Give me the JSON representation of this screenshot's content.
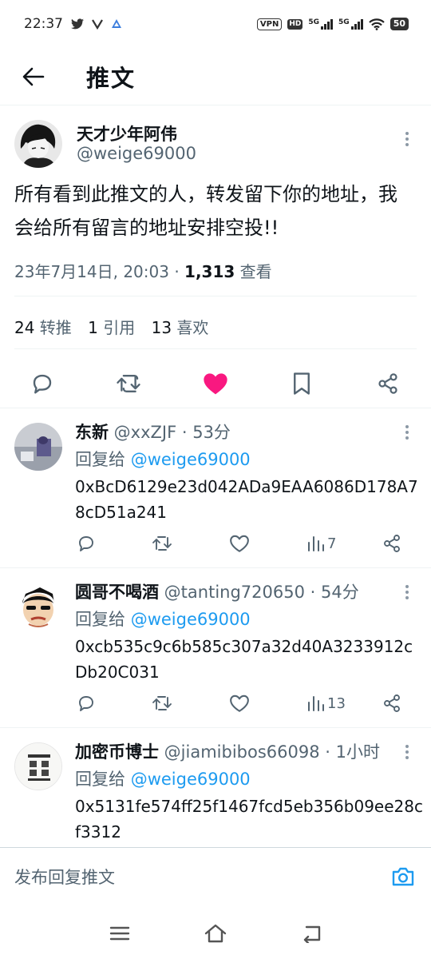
{
  "status": {
    "time": "22:37",
    "vpn": "VPN",
    "hd": "HD",
    "net1": "5G",
    "net2": "5G",
    "battery": "50",
    "icons": [
      "twitter-bird-icon",
      "app-v-icon",
      "app-a-icon",
      "vpn-badge",
      "hd-badge",
      "signal-5g-icon",
      "signal-5g-icon",
      "wifi-icon",
      "battery-icon"
    ]
  },
  "header": {
    "title": "推文",
    "back_icon": "arrow-left-icon"
  },
  "tweet": {
    "author_name": "天才少年阿伟",
    "author_handle": "@weige69000",
    "text": "所有看到此推文的人，转发留下你的地址，我会给所有留言的地址安排空投!!",
    "timestamp": "23年7月14日, 20:03 · ",
    "views_count": "1,313",
    "views_label": " 查看",
    "retweets_count": "24",
    "retweets_label": " 转推",
    "quotes_count": "1",
    "quotes_label": " 引用",
    "likes_count": "13",
    "likes_label": " 喜欢",
    "liked": true,
    "like_color": "#f91880"
  },
  "replies": [
    {
      "name": "东新",
      "meta": " @xxZJF · 53分",
      "reply_prefix": "回复给 ",
      "reply_to": "@weige69000",
      "text": "0xBcD6129e23d042ADa9EAA6086D178A78cD51a241",
      "views": "7"
    },
    {
      "name": "圆哥不喝酒",
      "meta": " @tanting720650 · 54分",
      "reply_prefix": "回复给 ",
      "reply_to": "@weige69000",
      "text": "0xcb535c9c6b585c307a32d40A3233912cDb20C031",
      "views": "13"
    },
    {
      "name": "加密币博士",
      "meta": " @jiamibibos66098 · 1小时",
      "reply_prefix": "回复给 ",
      "reply_to": "@weige69000",
      "text": "0x5131fe574ff25f1467fcd5eb356b09ee28cf3312",
      "views": ""
    }
  ],
  "compose": {
    "placeholder": "发布回复推文"
  },
  "colors": {
    "accent": "#1d9bf0",
    "text": "#0f1419",
    "secondary": "#536471",
    "like": "#f91880"
  }
}
